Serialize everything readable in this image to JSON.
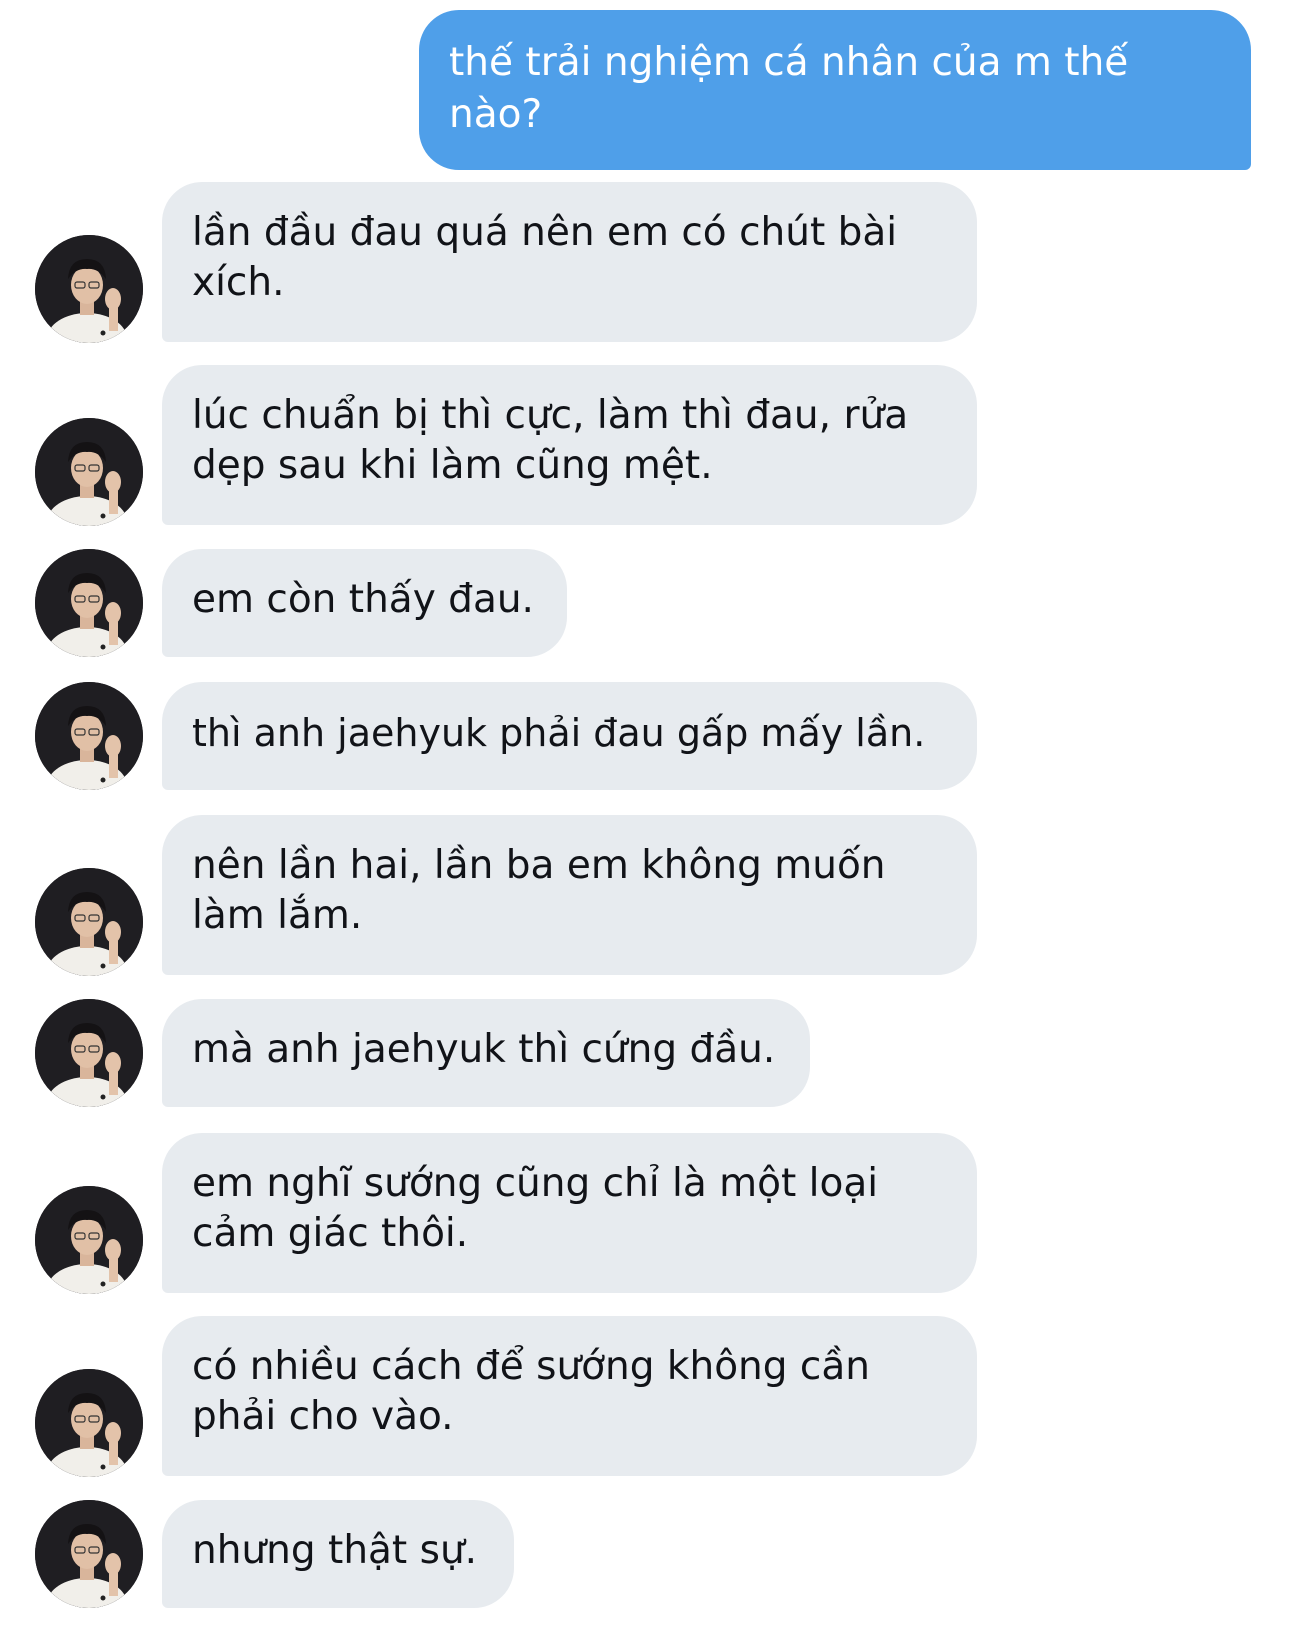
{
  "conversation": {
    "sent_message": "thế trải nghiệm cá nhân của m thế nào?",
    "received_messages": [
      "lần đầu đau quá nên em có chút bài xích.",
      "lúc chuẩn bị thì cực, làm thì đau, rửa dẹp sau khi làm cũng mệt.",
      "em còn thấy đau.",
      "thì anh jaehyuk phải đau gấp mấy lần.",
      "nên lần hai, lần ba em không muốn làm lắm.",
      "mà anh jaehyuk thì cứng đầu.",
      "em nghĩ sướng cũng chỉ là một loại cảm giác thôi.",
      "có nhiều cách để sướng không cần phải cho vào.",
      "nhưng thật sự."
    ]
  },
  "colors": {
    "sent_bubble": "#4f9fe9",
    "received_bubble": "#e7ebef",
    "sent_text": "#ffffff",
    "received_text": "#111318",
    "background": "#ffffff"
  },
  "icons": {
    "avatar": "profile-photo-avatar"
  }
}
